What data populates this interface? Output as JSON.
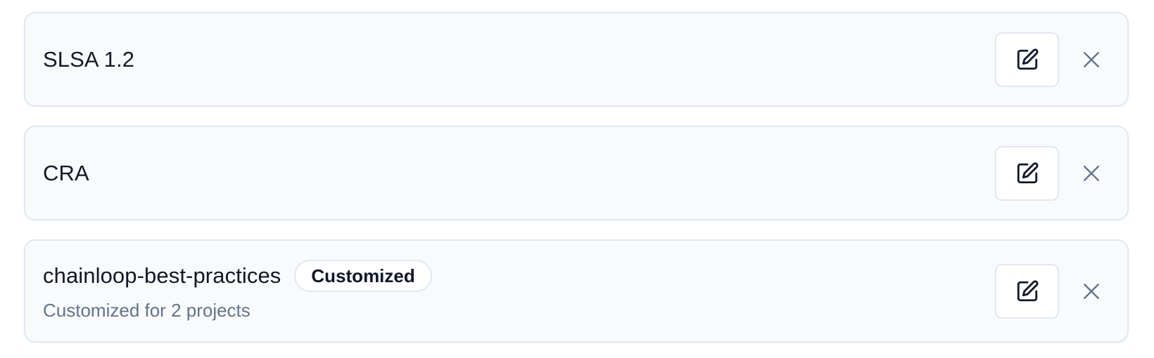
{
  "colors": {
    "card_background": "#f8fafc",
    "card_border": "#e2e8f0",
    "title_text": "#111827",
    "subtitle_text": "#64748b",
    "icon_dark": "#0f172a",
    "close_icon": "#64748b"
  },
  "items": [
    {
      "title": "SLSA 1.2",
      "badge": "",
      "subtitle": "",
      "edit_icon": "edit-icon",
      "remove_icon": "close-icon"
    },
    {
      "title": "CRA",
      "badge": "",
      "subtitle": "",
      "edit_icon": "edit-icon",
      "remove_icon": "close-icon"
    },
    {
      "title": "chainloop-best-practices",
      "badge": "Customized",
      "subtitle": "Customized for 2 projects",
      "edit_icon": "edit-icon",
      "remove_icon": "close-icon"
    }
  ]
}
